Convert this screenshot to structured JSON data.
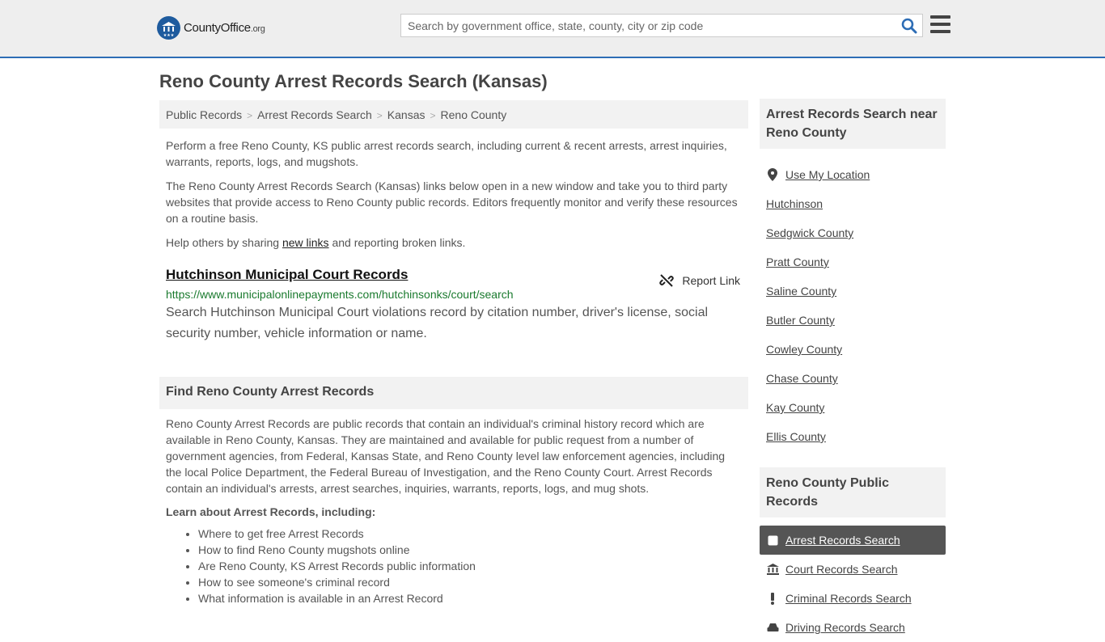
{
  "header": {
    "logo_main": "CountyOffice",
    "logo_suffix": ".org",
    "search_placeholder": "Search by government office, state, county, city or zip code"
  },
  "page_title": "Reno County Arrest Records Search (Kansas)",
  "breadcrumb": [
    "Public Records",
    "Arrest Records Search",
    "Kansas",
    "Reno County"
  ],
  "intro": {
    "p1": "Perform a free Reno County, KS public arrest records search, including current & recent arrests, arrest inquiries, warrants, reports, logs, and mugshots.",
    "p2": "The Reno County Arrest Records Search (Kansas) links below open in a new window and take you to third party websites that provide access to Reno County public records. Editors frequently monitor and verify these resources on a routine basis.",
    "p3_before": "Help others by sharing ",
    "p3_link": "new links",
    "p3_after": " and reporting broken links."
  },
  "result": {
    "title": "Hutchinson Municipal Court Records",
    "report_label": "Report Link",
    "url": "https://www.municipalonlinepayments.com/hutchinsonks/court/search",
    "description": "Search Hutchinson Municipal Court violations record by citation number, driver's license, social security number, vehicle information or name."
  },
  "find_section": {
    "heading": "Find Reno County Arrest Records",
    "body": "Reno County Arrest Records are public records that contain an individual's criminal history record which are available in Reno County, Kansas. They are maintained and available for public request from a number of government agencies, from Federal, Kansas State, and Reno County level law enforcement agencies, including the local Police Department, the Federal Bureau of Investigation, and the Reno County Court. Arrest Records contain an individual's arrests, arrest searches, inquiries, warrants, reports, logs, and mug shots.",
    "learn_heading": "Learn about Arrest Records, including:",
    "learn_items": [
      "Where to get free Arrest Records",
      "How to find Reno County mugshots online",
      "Are Reno County, KS Arrest Records public information",
      "How to see someone's criminal record",
      "What information is available in an Arrest Record"
    ]
  },
  "sidebar": {
    "nearby_heading": "Arrest Records Search near Reno County",
    "use_location": "Use My Location",
    "nearby": [
      "Hutchinson",
      "Sedgwick County",
      "Pratt County",
      "Saline County",
      "Butler County",
      "Cowley County",
      "Chase County",
      "Kay County",
      "Ellis County"
    ],
    "public_heading": "Reno County Public Records",
    "public_links": [
      {
        "label": "Arrest Records Search",
        "icon": "square-icon",
        "active": true
      },
      {
        "label": "Court Records Search",
        "icon": "courthouse-icon",
        "active": false
      },
      {
        "label": "Criminal Records Search",
        "icon": "exclamation-icon",
        "active": false
      },
      {
        "label": "Driving Records Search",
        "icon": "car-icon",
        "active": false
      }
    ]
  },
  "colors": {
    "accent_blue": "#2d6db5",
    "url_green": "#1a7a2e",
    "active_bg": "#555555"
  }
}
